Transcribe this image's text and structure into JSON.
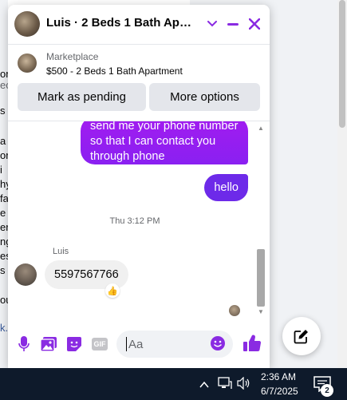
{
  "background": {
    "left_fragments": [
      "on",
      "ec",
      "s T",
      "a",
      "or",
      "i",
      "hy",
      "fa",
      "e",
      "er",
      "ng",
      "es",
      "s",
      "ou",
      "k."
    ]
  },
  "chat": {
    "title": "Luis · 2 Beds 1 Bath Apart...",
    "listing": {
      "source": "Marketplace",
      "title": "$500 - 2 Beds 1 Bath Apartment",
      "pending_button": "Mark as pending",
      "more_button": "More options"
    },
    "messages": {
      "outgoing_long": "send me your phone number so that I can contact you through phone",
      "outgoing_hello": "hello",
      "time_divider": "Thu 3:12 PM",
      "sender_name": "Luis",
      "incoming": "5597567766",
      "reaction": "👍"
    },
    "composer": {
      "placeholder": "Aa",
      "gif_label": "GIF"
    }
  },
  "taskbar": {
    "time": "2:36 AM",
    "date": "6/7/2025",
    "notification_count": "2"
  },
  "colors": {
    "accent": "#8a2be2",
    "bubble_out": "#8b1cf3",
    "taskbar": "#0e1a2b"
  }
}
